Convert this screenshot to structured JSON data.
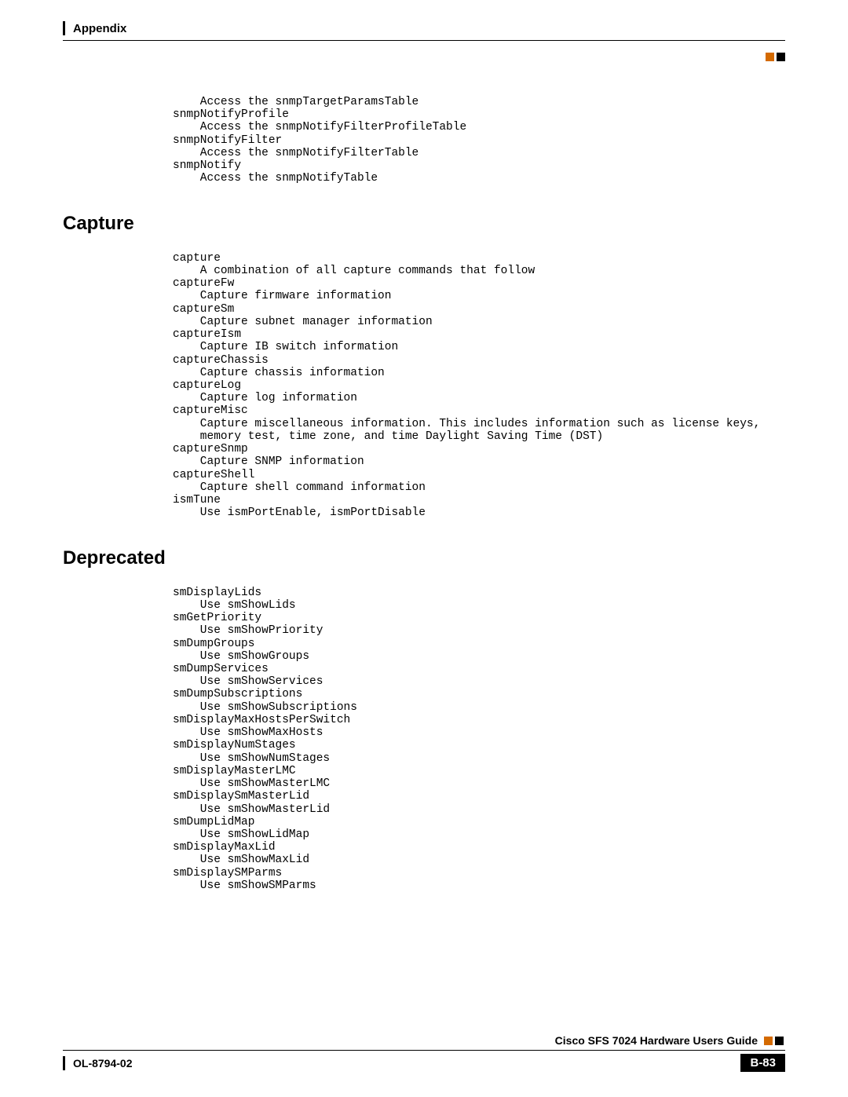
{
  "header": {
    "section": "Appendix"
  },
  "blocks": {
    "intro": "    Access the snmpTargetParamsTable\nsnmpNotifyProfile\n    Access the snmpNotifyFilterProfileTable\nsnmpNotifyFilter\n    Access the snmpNotifyFilterTable\nsnmpNotify\n    Access the snmpNotifyTable",
    "capture_heading": "Capture",
    "capture": "capture\n    A combination of all capture commands that follow\ncaptureFw\n    Capture firmware information\ncaptureSm\n    Capture subnet manager information\ncaptureIsm\n    Capture IB switch information\ncaptureChassis\n    Capture chassis information\ncaptureLog\n    Capture log information\ncaptureMisc\n    Capture miscellaneous information. This includes information such as license keys,\n    memory test, time zone, and time Daylight Saving Time (DST)\ncaptureSnmp\n    Capture SNMP information\ncaptureShell\n    Capture shell command information\nismTune\n    Use ismPortEnable, ismPortDisable",
    "deprecated_heading": "Deprecated",
    "deprecated": "smDisplayLids\n    Use smShowLids\nsmGetPriority\n    Use smShowPriority\nsmDumpGroups\n    Use smShowGroups\nsmDumpServices\n    Use smShowServices\nsmDumpSubscriptions\n    Use smShowSubscriptions\nsmDisplayMaxHostsPerSwitch\n    Use smShowMaxHosts\nsmDisplayNumStages\n    Use smShowNumStages\nsmDisplayMasterLMC\n    Use smShowMasterLMC\nsmDisplaySmMasterLid\n    Use smShowMasterLid\nsmDumpLidMap\n    Use smShowLidMap\nsmDisplayMaxLid\n    Use smShowMaxLid\nsmDisplaySMParms\n    Use smShowSMParms"
  },
  "footer": {
    "title": "Cisco SFS 7024 Hardware Users Guide",
    "doc_id": "OL-8794-02",
    "page": "B-83"
  }
}
